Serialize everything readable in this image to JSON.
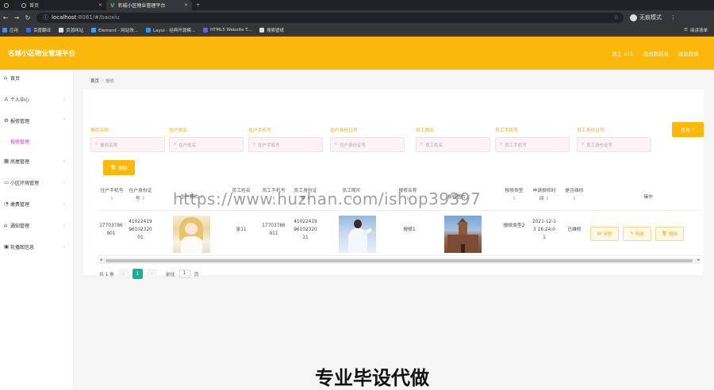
{
  "browser": {
    "tabs": [
      {
        "title": "首页"
      },
      {
        "title": "首页"
      },
      {
        "title": "名城小区物业管理平台"
      }
    ],
    "new_tab": "+",
    "url_host": "localhost",
    "url_rest": ":8081/#/baoxiu",
    "profile": "无痕模式",
    "bookmarks": [
      "应用",
      "百度翻译",
      "资源网站",
      "Element - 网站快...",
      "Layui - 经典开源模...",
      "HTML5 Website T...",
      "搜索壁纸"
    ],
    "reading_list": "阅读清单"
  },
  "header": {
    "title": "名城小区物业管理平台",
    "user": "员工 a11",
    "back_label": "退出到前台",
    "logout_label": "退出登录"
  },
  "sidebar": {
    "items": [
      {
        "label": "首页",
        "icon": "home-icon"
      },
      {
        "label": "个人中心",
        "icon": "user-icon"
      },
      {
        "label": "报修管理",
        "icon": "settings-icon"
      },
      {
        "label": "报修管理",
        "icon": ""
      },
      {
        "label": "房屋管理",
        "icon": "building-icon"
      },
      {
        "label": "小区环境管理",
        "icon": "monitor-icon"
      },
      {
        "label": "缴费管理",
        "icon": "wallet-icon"
      },
      {
        "label": "通知管理",
        "icon": "bell-icon"
      },
      {
        "label": "轮播图信息",
        "icon": "image-icon"
      }
    ]
  },
  "breadcrumb": {
    "home": "首页",
    "sep": "/",
    "current": "报修"
  },
  "filters": [
    {
      "label": "报修名称",
      "placeholder": "报修名称"
    },
    {
      "label": "住户姓名",
      "placeholder": "住户姓名"
    },
    {
      "label": "住户手机号",
      "placeholder": "住户手机号"
    },
    {
      "label": "住户身份证号",
      "placeholder": "住户身份证号"
    },
    {
      "label": "员工姓名",
      "placeholder": "员工姓名"
    },
    {
      "label": "员工手机号",
      "placeholder": "员工手机号"
    },
    {
      "label": "员工身份证号",
      "placeholder": "员工身份证号"
    }
  ],
  "buttons": {
    "search": "查询",
    "delete": "删除"
  },
  "table": {
    "headers": [
      "住户手机号",
      "住户身份证号",
      "住户照片",
      "员工姓名",
      "员工手机号",
      "员工身份证号",
      "员工照片",
      "报修名称",
      "报修图片",
      "报修类型",
      "申请报修时间",
      "是否维修",
      "操作"
    ],
    "row": {
      "resident_phone": "17703786901",
      "resident_id": "410224199610232001",
      "staff_name": "张11",
      "staff_phone": "17703786911",
      "staff_id": "410224199610232011",
      "repair_name": "报修1",
      "repair_type": "报修类型2",
      "apply_time": "2021-12-13 16:24:01",
      "status": "已维修"
    },
    "actions": [
      "详情",
      "修改",
      "删除"
    ]
  },
  "pagination": {
    "total": "共 1 条",
    "prev": "‹",
    "page": "1",
    "next": "›",
    "goto": "前往",
    "goto_value": "1",
    "unit": "页"
  },
  "overlay": {
    "watermark": "https://www.huzhan.com/ishop39397",
    "caption": "专业毕设代做"
  }
}
